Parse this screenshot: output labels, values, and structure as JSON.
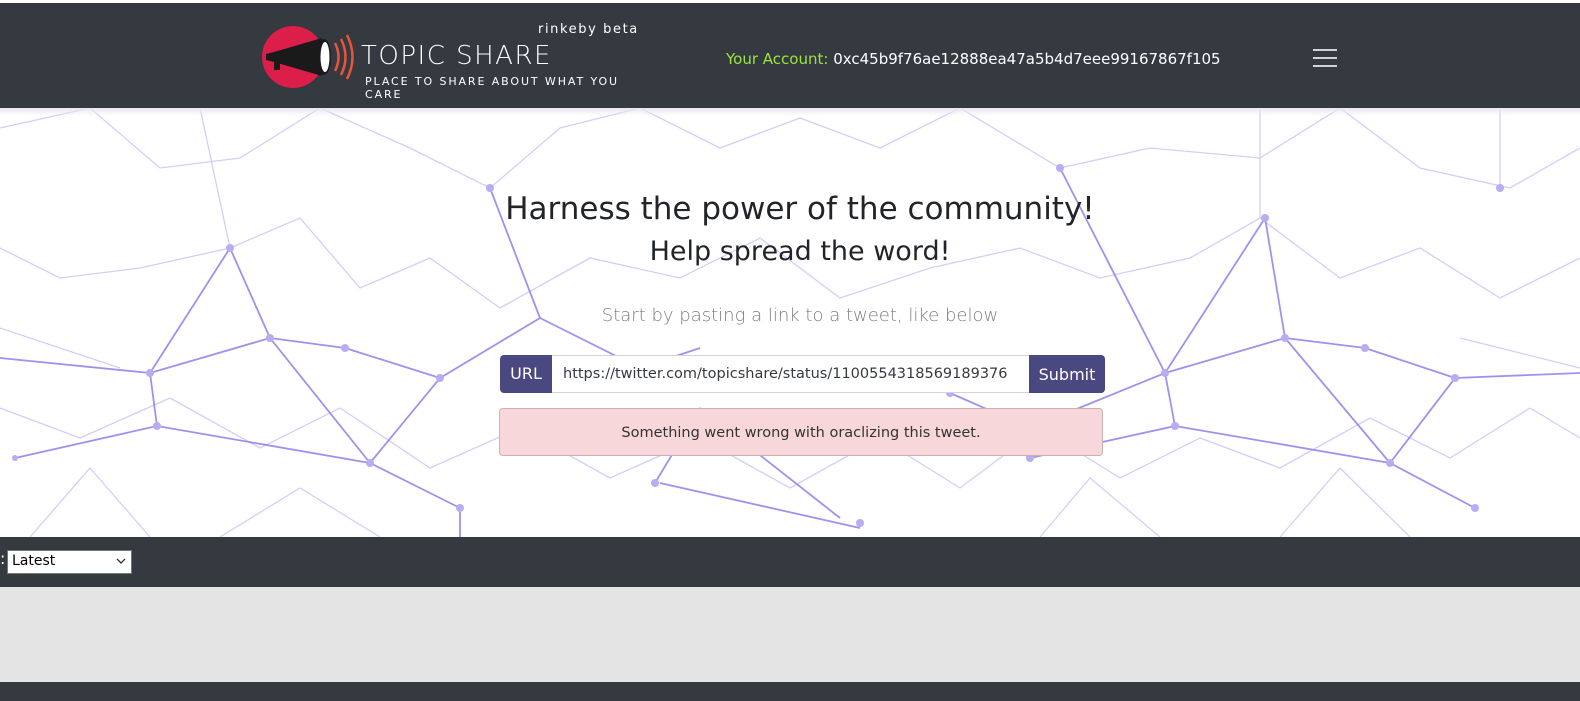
{
  "header": {
    "brand": {
      "tag": "rinkeby beta",
      "title": "TOPIC SHARE",
      "subtitle": "PLACE TO SHARE ABOUT WHAT YOU CARE"
    },
    "account": {
      "label": "Your Account:",
      "value": "0xc45b9f76ae12888ea47a5b4d7eee99167867f105"
    },
    "menu_icon": "hamburger-icon"
  },
  "hero": {
    "headline": "Harness the power of the community!",
    "subheadline": "Help spread the word!",
    "lead": "Start by pasting a link to a tweet, like below",
    "url_form": {
      "prefix": "URL",
      "value": "https://twitter.com/topicshare/status/1100554318569189376",
      "submit_label": "Submit"
    },
    "alert": "Something went wrong with oraclizing this tweet."
  },
  "filter": {
    "colon": ":",
    "sort_selected": "Latest"
  },
  "colors": {
    "navbar": "#343a40",
    "brand_red": "#dc1f4a",
    "account_label": "#9be33f",
    "button": "#4a4880",
    "alert_bg": "#f8d7da",
    "network_lines": "#7b6ee6"
  }
}
